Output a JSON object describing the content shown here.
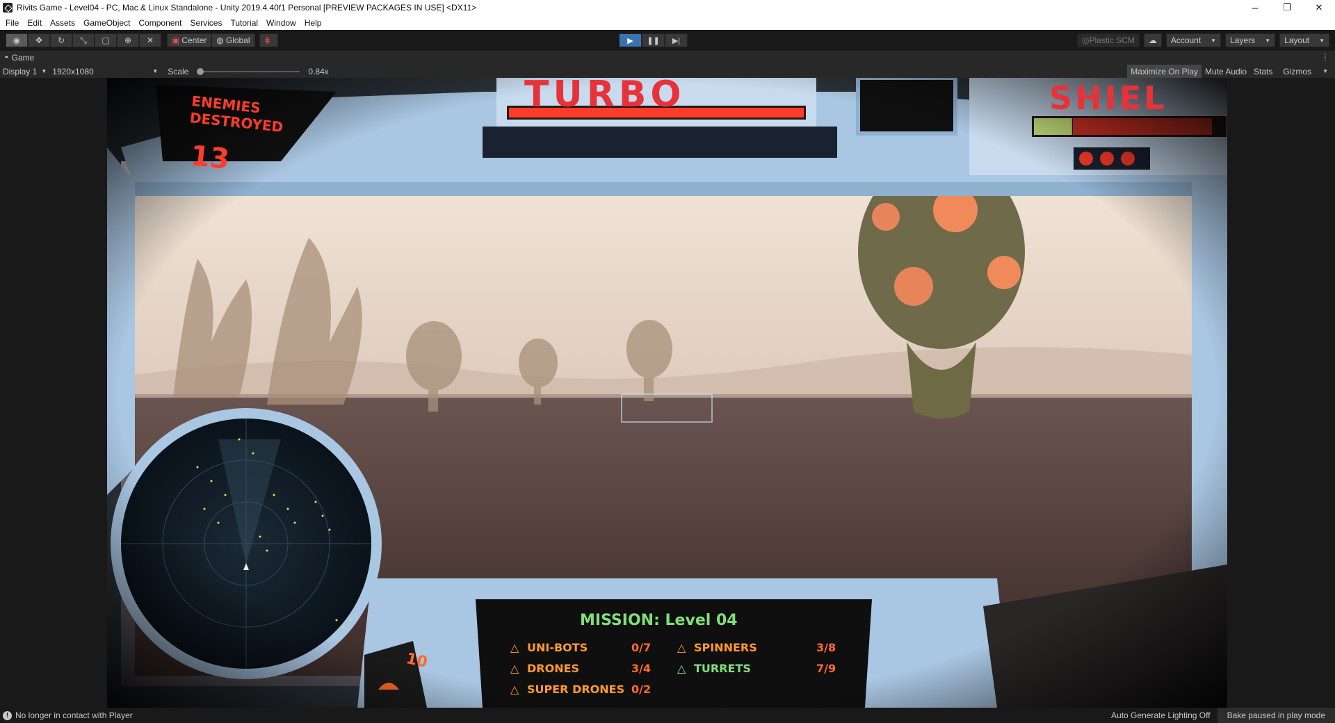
{
  "window": {
    "title": "Rivits Game - Level04 - PC, Mac & Linux Standalone - Unity 2019.4.40f1 Personal [PREVIEW PACKAGES IN USE] <DX11>",
    "minimize": "─",
    "restore": "❐",
    "close": "✕"
  },
  "menu": [
    "File",
    "Edit",
    "Assets",
    "GameObject",
    "Component",
    "Services",
    "Tutorial",
    "Window",
    "Help"
  ],
  "toolbar": {
    "pivot": "Center",
    "space": "Global",
    "plastic": "Plastic SCM",
    "account": "Account",
    "layers": "Layers",
    "layout": "Layout"
  },
  "tab": {
    "label": "Game"
  },
  "gamebar": {
    "display": "Display 1",
    "resolution": "1920x1080",
    "scale_label": "Scale",
    "scale_value": "0.84x",
    "maximize": "Maximize On Play",
    "mute": "Mute Audio",
    "stats": "Stats",
    "gizmos": "Gizmos"
  },
  "hud": {
    "enemies_line1": "ENEMIES",
    "enemies_line2": "DESTROYED",
    "enemies_count": "13",
    "turbo": "TURBO",
    "turbo_level": 1.0,
    "shield": "SHIEL",
    "shield_level": 0.2,
    "lives": "10",
    "mission_title": "MISSION: Level 04",
    "objectives": [
      {
        "name": "UNI-BOTS",
        "value": "0/7"
      },
      {
        "name": "DRONES",
        "value": "3/4"
      },
      {
        "name": "SUPER DRONES",
        "value": "0/2"
      },
      {
        "name": "SPINNERS",
        "value": "3/8"
      },
      {
        "name": "TURRETS",
        "value": "7/9"
      }
    ],
    "colors": {
      "hud_red": "#ff3b2a",
      "hud_green": "#7fe07a",
      "frame_blue": "#a9c6e2",
      "sky": "#e9dccd"
    }
  },
  "status": {
    "message": "No longer in contact with Player",
    "lighting": "Auto Generate Lighting Off",
    "bake": "Bake paused in play mode"
  }
}
